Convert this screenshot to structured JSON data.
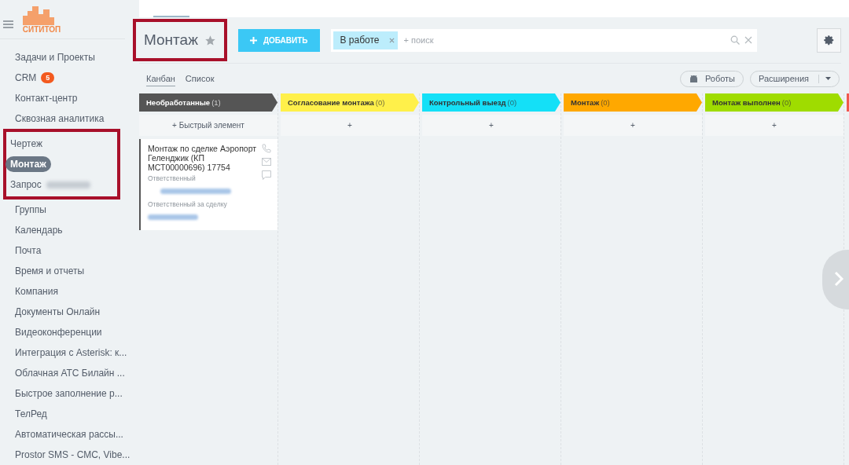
{
  "logo": {
    "text": "СИТИТОП"
  },
  "sidebar": {
    "items": [
      {
        "label": "Задачи и Проекты",
        "selected": false,
        "group": false
      },
      {
        "label": "CRM",
        "badge": "5",
        "selected": false,
        "group": false
      },
      {
        "label": "Контакт-центр",
        "selected": false,
        "group": false
      },
      {
        "label": "Сквозная аналитика",
        "selected": false,
        "group": false
      },
      {
        "label": "Чертеж",
        "selected": false,
        "group": true
      },
      {
        "label": "Монтаж",
        "selected": true,
        "group": true
      },
      {
        "label": "Запрос",
        "blurred": true,
        "selected": false,
        "group": true
      },
      {
        "label": "Группы",
        "selected": false,
        "group": false
      },
      {
        "label": "Календарь",
        "selected": false,
        "group": false
      },
      {
        "label": "Почта",
        "selected": false,
        "group": false
      },
      {
        "label": "Время и отчеты",
        "selected": false,
        "group": false
      },
      {
        "label": "Компания",
        "selected": false,
        "group": false
      },
      {
        "label": "Документы Онлайн",
        "selected": false,
        "group": false
      },
      {
        "label": "Видеоконференции",
        "selected": false,
        "group": false
      },
      {
        "label": "Интеграция с Asterisk: к...",
        "selected": false,
        "group": false
      },
      {
        "label": "Облачная АТС Билайн ...",
        "selected": false,
        "group": false
      },
      {
        "label": "Быстрое заполнение р...",
        "selected": false,
        "group": false
      },
      {
        "label": "ТелРед",
        "selected": false,
        "group": false
      },
      {
        "label": "Автоматическая рассы...",
        "selected": false,
        "group": false
      },
      {
        "label": "Prostor SMS - СМС, Vibe...",
        "selected": false,
        "group": false
      }
    ]
  },
  "header": {
    "title": "Монтаж",
    "add_button": "ДОБАВИТЬ",
    "filter_tag": "В работе",
    "search": {
      "placeholder": "+ поиск"
    }
  },
  "view_tabs": [
    {
      "label": "Канбан",
      "selected": true
    },
    {
      "label": "Список",
      "selected": false
    }
  ],
  "actions": {
    "robots": "Роботы",
    "extensions": "Расширения"
  },
  "columns": [
    {
      "name": "Необработанные",
      "count": "(1)",
      "color": "#555555",
      "quick_add": "+  Быстрый элемент",
      "cards": [
        {
          "title": "Монтаж по сделке Аэропорт Геленджик (КП МСТ00000696) 17754",
          "field_1": "Ответственный",
          "field_2": "Ответственный за сделку"
        }
      ]
    },
    {
      "name": "Согласование монтажа",
      "count": "(0)",
      "color": "#fff04a",
      "quick_add": "+"
    },
    {
      "name": "Контрольный выезд",
      "count": "(0)",
      "color": "#14e0f7",
      "quick_add": "+"
    },
    {
      "name": "Монтаж",
      "count": "(0)",
      "color": "#ffa800",
      "quick_add": "+"
    },
    {
      "name": "Монтаж выполнен",
      "count": "(0)",
      "color": "#9fdc00",
      "quick_add": "+"
    }
  ]
}
